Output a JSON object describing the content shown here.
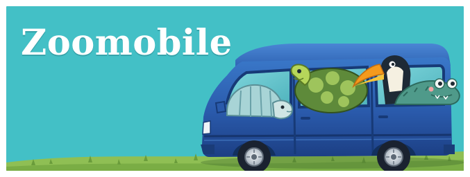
{
  "banner": {
    "title": "Zoomobile"
  },
  "colors": {
    "background": "#43c0c6",
    "title": "#ffffff",
    "van_body": "#2c5fb0",
    "van_dark": "#183c78",
    "grass": "#8fbf54"
  },
  "illustration": {
    "vehicle": "van-icon",
    "passengers": [
      "armadillo-icon",
      "turtle-icon",
      "toucan-icon",
      "crocodile-icon"
    ]
  }
}
